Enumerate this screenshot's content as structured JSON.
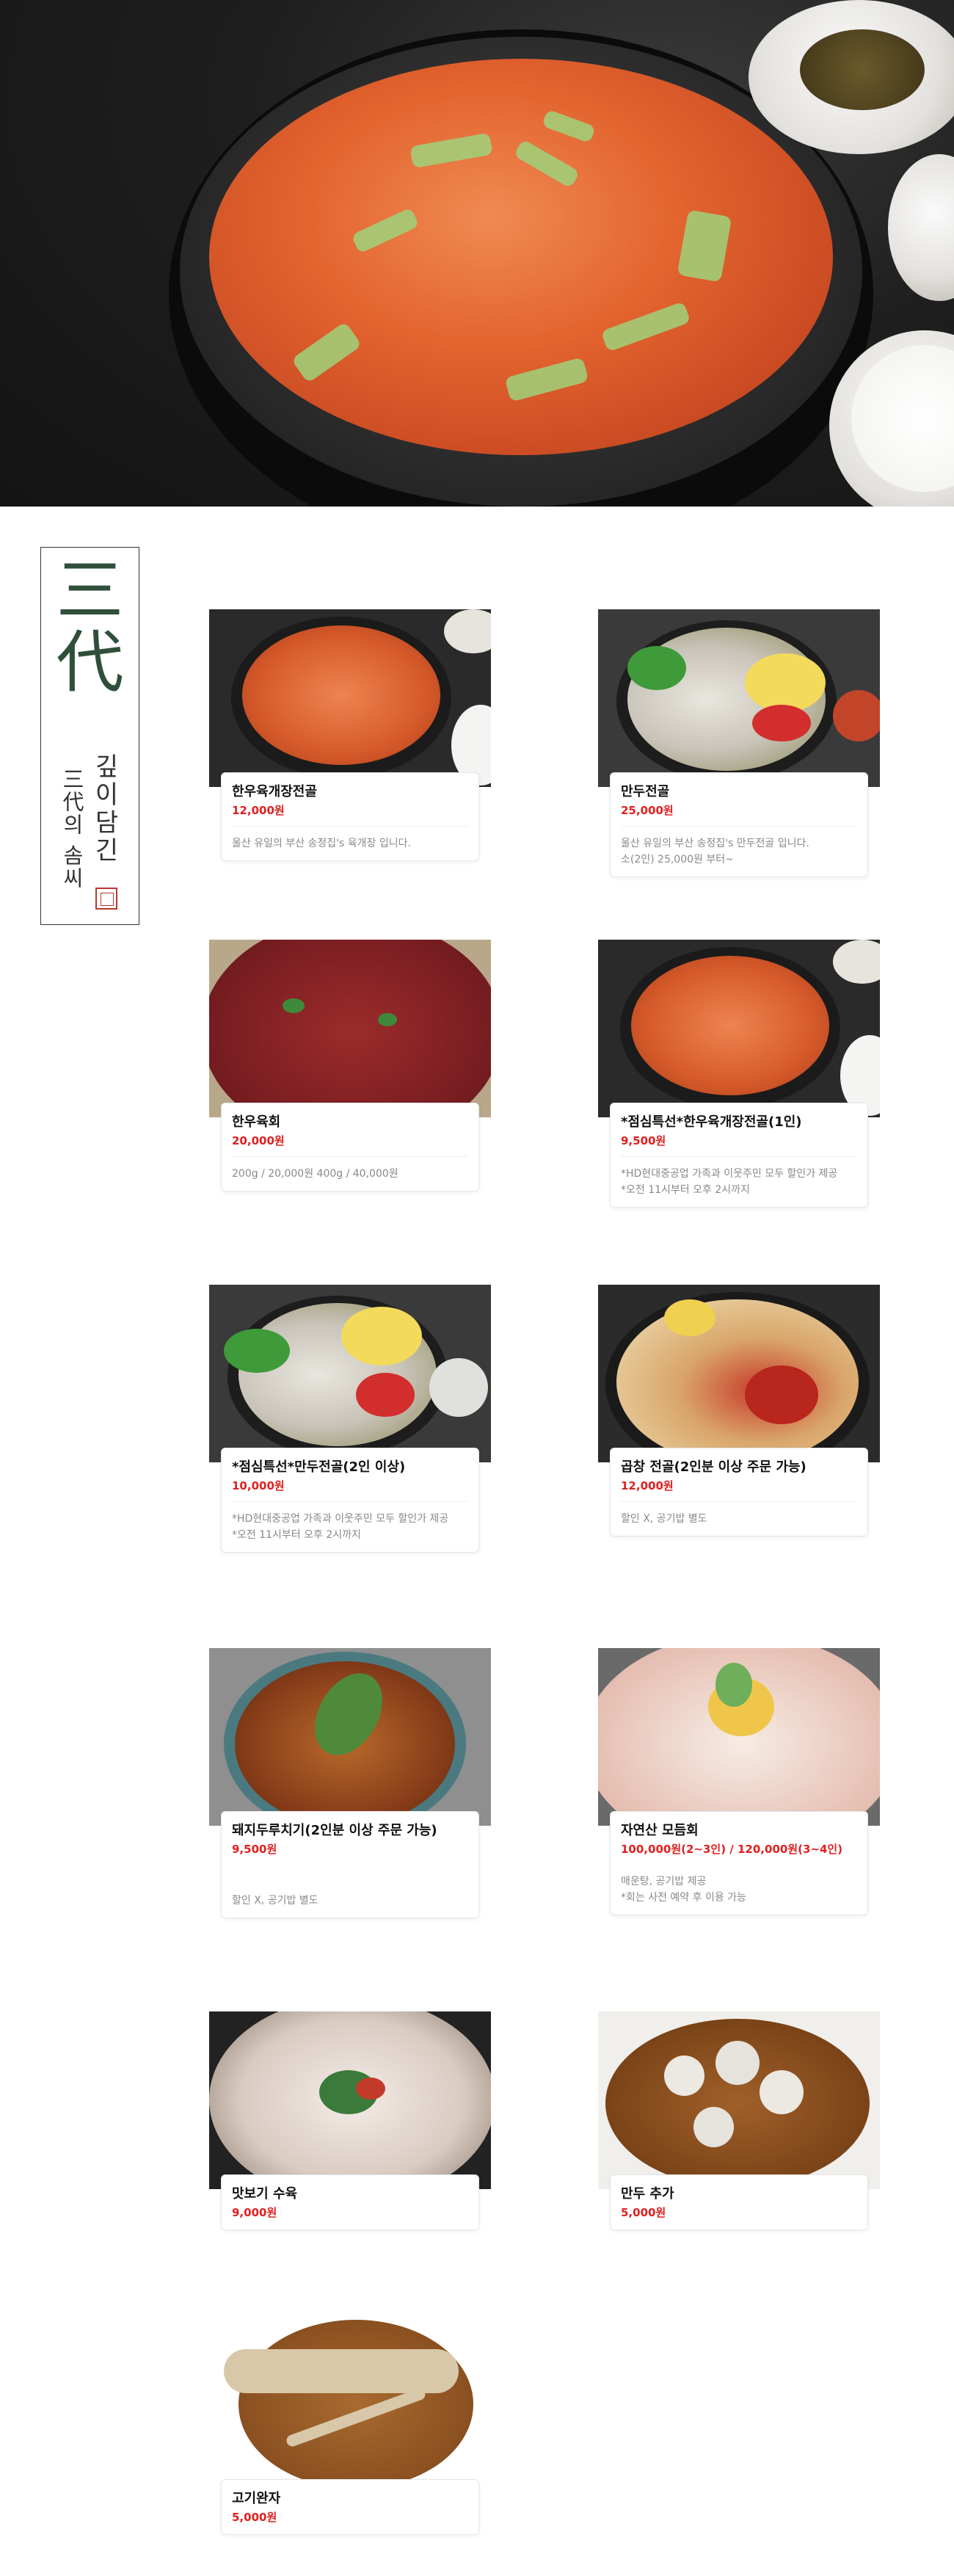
{
  "logo": {
    "main_top": "三",
    "main_bottom": "代",
    "sub_right": "깊이담긴",
    "sub_left": "三代의 솜씨"
  },
  "menu": [
    {
      "name": "한우육개장전골",
      "price": "12,000원",
      "desc": "울산 유일의 부산 송정집's 육개장 입니다."
    },
    {
      "name": "만두전골",
      "price": "25,000원",
      "desc": "울산 유일의 부산 송정집's 만두전골 입니다.\n소(2인) 25,000원 부터~"
    },
    {
      "name": "한우육회",
      "price": "20,000원",
      "desc": "200g / 20,000원  400g / 40,000원"
    },
    {
      "name": "*점심특선*한우육개장전골(1인)",
      "price": "9,500원",
      "desc": "*HD현대중공업 가족과 이웃주민 모두 할인가 제공\n*오전 11시부터 오후 2시까지"
    },
    {
      "name": "*점심특선*만두전골(2인 이상)",
      "price": "10,000원",
      "desc": "*HD현대중공업 가족과 이웃주민 모두 할인가 제공\n*오전 11시부터 오후 2시까지"
    },
    {
      "name": "곱창 전골(2인분 이상 주문 가능)",
      "price": "12,000원",
      "desc": "할인 X, 공기밥 별도"
    },
    {
      "name": "돼지두루치기(2인분 이상 주문 가능)",
      "price": "9,500원",
      "desc": "할인 X, 공기밥 별도"
    },
    {
      "name": "자연산 모듬회",
      "price": "100,000원(2~3인) / 120,000원(3~4인)",
      "desc": "매운탕, 공기밥 제공\n*회는 사전 예약 후 이용 가능"
    },
    {
      "name": "맛보기 수육",
      "price": "9,000원",
      "desc": ""
    },
    {
      "name": "만두 추가",
      "price": "5,000원",
      "desc": ""
    },
    {
      "name": "고기완자",
      "price": "5,000원",
      "desc": ""
    }
  ],
  "colors": {
    "price": "#e02020",
    "logo_green": "#2f4f3a",
    "seal": "#b83a30"
  }
}
